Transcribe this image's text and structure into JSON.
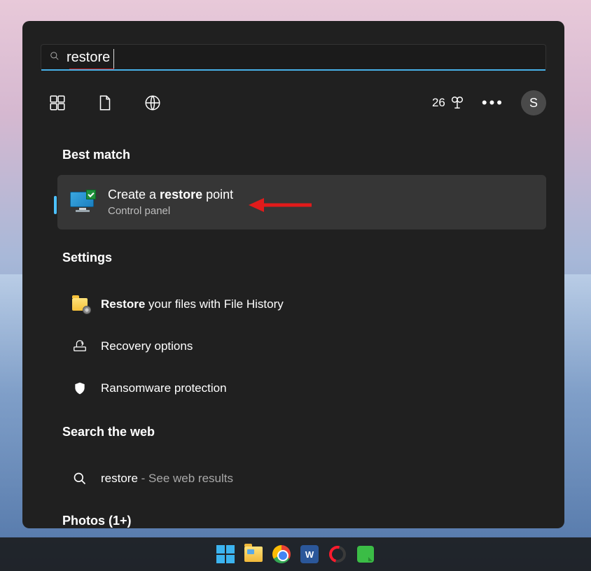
{
  "search": {
    "value": "restore"
  },
  "rewards": {
    "points": "26"
  },
  "avatar": {
    "initial": "S"
  },
  "sections": {
    "best_match_header": "Best match",
    "settings_header": "Settings",
    "web_header": "Search the web",
    "photos_header": "Photos (1+)"
  },
  "best_match": {
    "title_pre": "Create a ",
    "title_bold": "restore",
    "title_post": " point",
    "subtitle": "Control panel"
  },
  "settings_items": [
    {
      "bold": "Restore",
      "rest": " your files with File History"
    },
    {
      "bold": "",
      "rest": "Recovery options"
    },
    {
      "bold": "",
      "rest": "Ransomware protection"
    }
  ],
  "web_item": {
    "term": "restore",
    "suffix": " - See web results"
  },
  "taskbar": {
    "word_label": "W"
  }
}
